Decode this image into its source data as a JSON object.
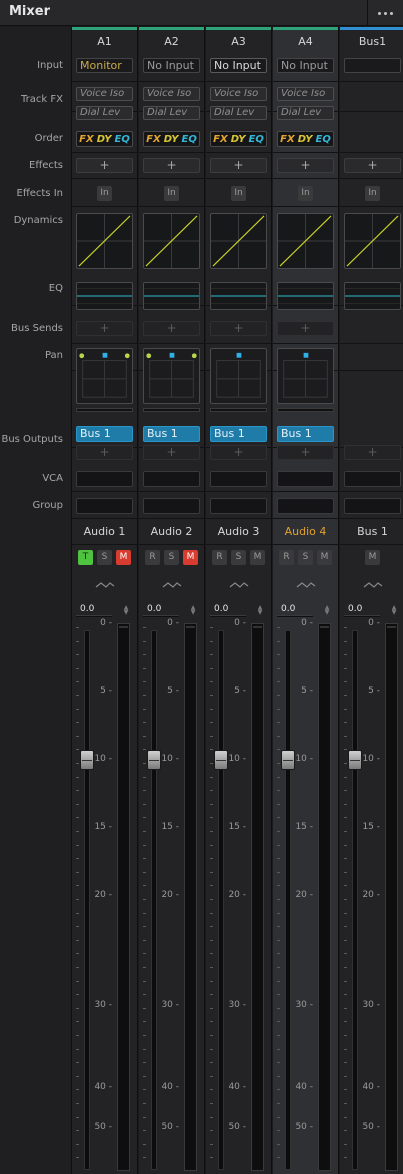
{
  "panel": {
    "title": "Mixer",
    "more_icon": "more-horizontal-icon"
  },
  "row_labels": {
    "input": "Input",
    "track_fx": "Track FX",
    "order": "Order",
    "effects": "Effects",
    "effects_in": "Effects In",
    "dynamics": "Dynamics",
    "eq": "EQ",
    "bus_sends": "Bus Sends",
    "pan": "Pan",
    "bus_outputs": "Bus Outputs",
    "vca": "VCA",
    "group": "Group"
  },
  "colors": {
    "track_green": "#2fa37a",
    "bus_blue": "#2f8fd0",
    "eq_line": "#2fbcd4",
    "dynamics_line": "#c8d228",
    "pan_dot": "#2fb0e8",
    "pan_side_dot": "#b8d44a"
  },
  "order_labels": {
    "fx": "FX",
    "dy": "DY",
    "eq": "EQ"
  },
  "add_symbol": "+",
  "in_label": "In",
  "meter_scale": [
    "0",
    "5",
    "10",
    "15",
    "20",
    "30",
    "40",
    "50"
  ],
  "channels": [
    {
      "id": "A1",
      "header": "A1",
      "input": "Monitor",
      "track_fx": [
        "Voice Iso",
        "Dial Lev"
      ],
      "bus_output": "Bus 1",
      "name": "Audio 1",
      "buttons": [
        "T",
        "S",
        "M"
      ],
      "selected": false,
      "gain_value": "0.0",
      "fader_db": 0
    },
    {
      "id": "A2",
      "header": "A2",
      "input": "No Input",
      "track_fx": [
        "Voice Iso",
        "Dial Lev"
      ],
      "bus_output": "Bus 1",
      "name": "Audio 2",
      "buttons": [
        "R",
        "S",
        "M"
      ],
      "selected": false,
      "gain_value": "0.0",
      "fader_db": 0
    },
    {
      "id": "A3",
      "header": "A3",
      "input": "No Input",
      "track_fx": [
        "Voice Iso",
        "Dial Lev"
      ],
      "bus_output": "Bus 1",
      "name": "Audio 3",
      "buttons": [
        "R",
        "S",
        "M"
      ],
      "selected": false,
      "gain_value": "0.0",
      "fader_db": 0
    },
    {
      "id": "A4",
      "header": "A4",
      "input": "No Input",
      "track_fx": [
        "Voice Iso",
        "Dial Lev"
      ],
      "bus_output": "Bus 1",
      "name": "Audio 4",
      "buttons": [
        "R",
        "S",
        "M"
      ],
      "selected": true,
      "gain_value": "0.0",
      "fader_db": 0
    },
    {
      "id": "Bus1",
      "header": "Bus1",
      "input": "",
      "track_fx": [],
      "bus_output": "",
      "name": "Bus 1",
      "buttons": [
        "M"
      ],
      "selected": false,
      "gain_value": "0.0",
      "fader_db": 0
    }
  ]
}
